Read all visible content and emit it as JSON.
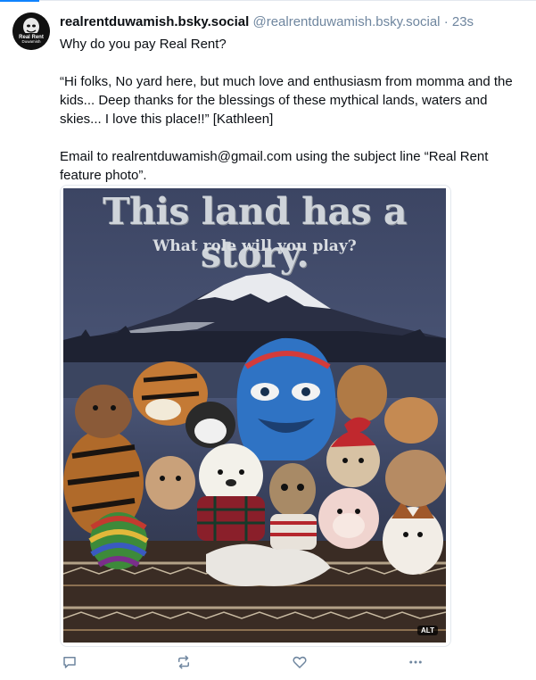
{
  "post": {
    "display_name": "realrentduwamish.bsky.social",
    "handle": "@realrentduwamish.bsky.social",
    "separator": "·",
    "timestamp": "23s",
    "avatar_text": {
      "line1": "Real Rent",
      "line2": "Duwamish"
    },
    "text": {
      "paragraph1": "Why do you pay Real Rent?",
      "paragraph2": "“Hi folks, No yard here, but much love and enthusiasm from momma and the kids... Deep thanks for the blessings of these mythical lands, waters and skies... I love this place!!” [Kathleen]",
      "paragraph3": "Email to realrentduwamish@gmail.com using the subject line “Real Rent feature photo”."
    },
    "image": {
      "sign_title": "This land has a story.",
      "sign_subtitle": "What role will you play?",
      "alt_badge": "ALT"
    },
    "actions": [
      {
        "name": "reply",
        "icon": "speech-bubble-icon"
      },
      {
        "name": "repost",
        "icon": "repost-arrows-icon"
      },
      {
        "name": "like",
        "icon": "heart-icon"
      },
      {
        "name": "more",
        "icon": "ellipsis-icon"
      }
    ]
  },
  "colors": {
    "accent": "#1083fe",
    "muted_text": "#6f869f",
    "text": "#0b0f14",
    "divider": "#e3e8ee"
  }
}
